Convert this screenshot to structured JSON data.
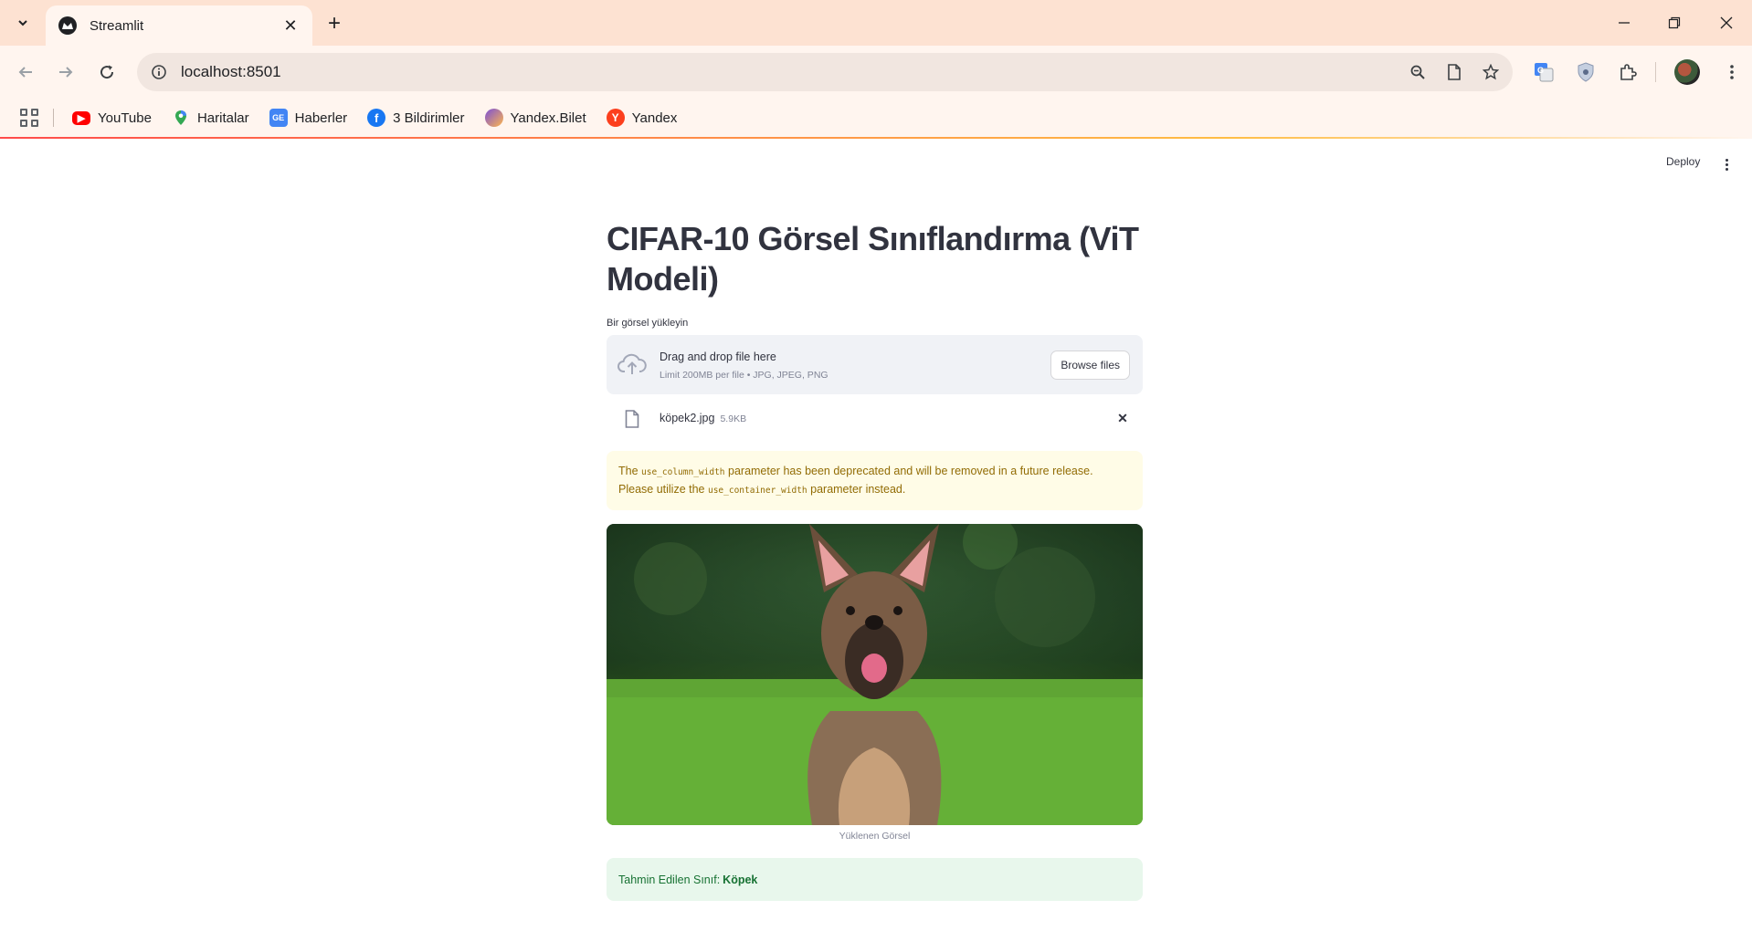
{
  "browser": {
    "tab_title": "Streamlit",
    "url": "localhost:8501",
    "bookmarks": [
      {
        "label": "YouTube",
        "icon": "youtube-icon",
        "color": "#ff0000"
      },
      {
        "label": "Haritalar",
        "icon": "maps-pin-icon",
        "color": "#34a853"
      },
      {
        "label": "Haberler",
        "icon": "news-icon",
        "color": "#4285f4"
      },
      {
        "label": "3 Bildirimler",
        "icon": "facebook-icon",
        "color": "#1877f2"
      },
      {
        "label": "Yandex.Bilet",
        "icon": "yandex-bilet-icon",
        "color": "#7b4fd6"
      },
      {
        "label": "Yandex",
        "icon": "yandex-icon",
        "color": "#fc3f1d"
      }
    ]
  },
  "app": {
    "deploy_label": "Deploy",
    "title": "CIFAR-10 Görsel Sınıflandırma (ViT Modeli)",
    "uploader": {
      "label": "Bir görsel yükleyin",
      "drag_text": "Drag and drop file here",
      "limit_text": "Limit 200MB per file • JPG, JPEG, PNG",
      "browse_label": "Browse files"
    },
    "file": {
      "name": "köpek2.jpg",
      "size": "5.9KB"
    },
    "warning": {
      "pre": "The ",
      "code1": "use_column_width",
      "mid": " parameter has been deprecated and will be removed in a future release. Please utilize the ",
      "code2": "use_container_width",
      "post": " parameter instead."
    },
    "image_caption": "Yüklenen Görsel",
    "prediction": {
      "label": "Tahmin Edilen Sınıf:",
      "value": "Köpek"
    }
  },
  "colors": {
    "accent": "#ff4b4b",
    "warning_bg": "#fffce7",
    "warning_text": "#926c05",
    "success_bg": "#e8f7ec",
    "success_text": "#177233"
  }
}
